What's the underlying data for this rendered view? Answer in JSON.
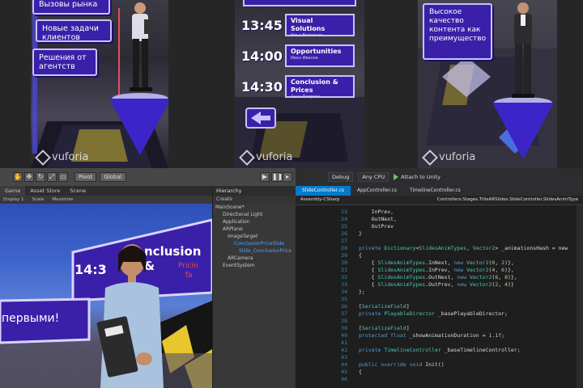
{
  "colors": {
    "sign_purple": "#3a20a8",
    "pedestal": "#3b25c9",
    "vs_accent": "#007acc",
    "keyword": "#569cd6",
    "type": "#4ec9b0"
  },
  "panel1": {
    "signs": [
      "Вызовы рынка",
      "Новые задачи клиентов",
      "Решения от агентств"
    ],
    "brand": "vuforia"
  },
  "panel2": {
    "slots": [
      {
        "time": "13:45",
        "title": "Visual Solutions",
        "sub": "Илья Волгинов"
      },
      {
        "time": "14:00",
        "title": "Opportunities",
        "sub": "Иван Иванов"
      },
      {
        "time": "14:30",
        "title": "Conclusion & Prices",
        "sub": "Анна Петрова"
      }
    ],
    "brand": "vuforia"
  },
  "panel3": {
    "sign": "Высокое качество контента как преимущество",
    "brand": "vuforia"
  },
  "unity": {
    "toolbar": {
      "pivot": "Pivot",
      "global": "Global"
    },
    "tabs": [
      "Game",
      "Asset Store",
      "Scene"
    ],
    "scenebar": {
      "display": "Display 1",
      "scale": "Scale",
      "maximize": "Maximize"
    },
    "game": {
      "banner_time": "14:3",
      "banner_text": "nclusion &",
      "banner_sub": "Pricin",
      "banner_tag": "Ta",
      "left_sign": "первыми!"
    },
    "hierarchy": {
      "tab": "Hierarchy",
      "create": "Create",
      "items": [
        "MainScene*",
        "Directional Light",
        "Application",
        "ARPlane",
        "ImageTarget",
        "ConclusionPriceSlide",
        "Slide_ConclusionPrice",
        "ARCamera",
        "EventSystem"
      ]
    }
  },
  "vs": {
    "toolbar": {
      "config": "Debug",
      "platform": "Any CPU",
      "attach": "Attach to Unity"
    },
    "tabs": [
      "SlideController.cs",
      "AppController.cs",
      "TimelineController.cs"
    ],
    "nav": {
      "left": "Assembly-CSharp",
      "right": "Controllers.Stages.TitleARSlides.SlideController.SlidesAnimType"
    },
    "line_numbers": [
      "23",
      "24",
      "25",
      "26",
      "27",
      "28",
      "29",
      "30",
      "31",
      "32",
      "33",
      "34",
      "35",
      "36",
      "37",
      "38",
      "39",
      "40",
      "41",
      "42",
      "43",
      "44",
      "45",
      "46"
    ]
  }
}
